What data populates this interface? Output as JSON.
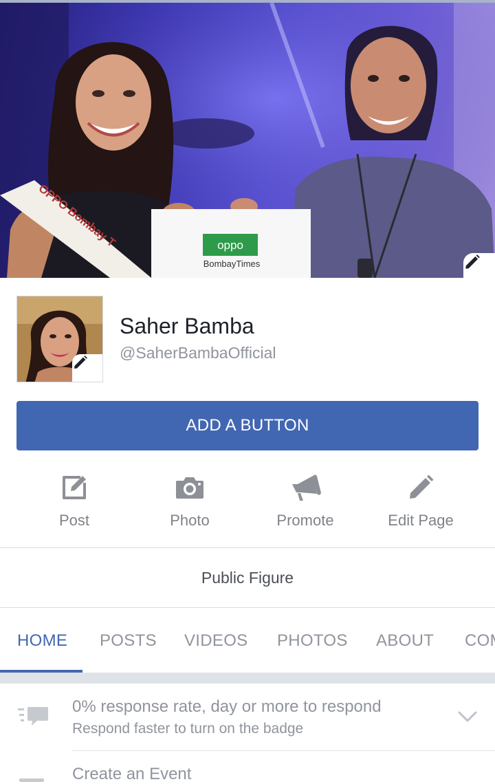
{
  "profile": {
    "name": "Saher Bamba",
    "handle": "@SaherBambaOfficial",
    "category": "Public Figure"
  },
  "cover": {
    "sash_text": "OPPO Bombay T",
    "card_brand": "oppo",
    "card_subtitle": "BombayTimes"
  },
  "cta": {
    "add_button_label": "ADD A BUTTON"
  },
  "actions": [
    {
      "label": "Post",
      "icon": "compose-icon"
    },
    {
      "label": "Photo",
      "icon": "camera-icon"
    },
    {
      "label": "Promote",
      "icon": "megaphone-icon"
    },
    {
      "label": "Edit Page",
      "icon": "pencil-icon"
    }
  ],
  "tabs": [
    {
      "label": "HOME",
      "active": true
    },
    {
      "label": "POSTS",
      "active": false
    },
    {
      "label": "VIDEOS",
      "active": false
    },
    {
      "label": "PHOTOS",
      "active": false
    },
    {
      "label": "ABOUT",
      "active": false
    },
    {
      "label": "COM",
      "active": false
    }
  ],
  "insights": {
    "response_title": "0% response rate, day or more to respond",
    "response_subtitle": "Respond faster to turn on the badge",
    "create_event": "Create an Event"
  },
  "colors": {
    "brand_blue": "#4267b2",
    "muted_text": "#90949c",
    "divider": "#dadde1"
  }
}
